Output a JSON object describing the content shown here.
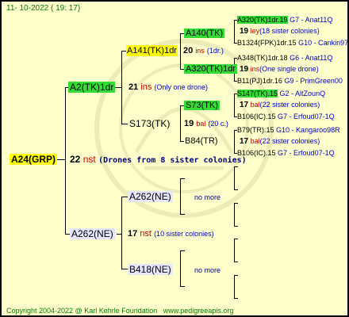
{
  "header": {
    "date": "11- 10-2022 ( 19: 17)"
  },
  "footer": {
    "copyright": "Copyright 2004-2022 @ Karl Kehrle Foundation",
    "site": "www.pedigreeapis.org"
  },
  "root": {
    "name": "A24(GRP)",
    "count": "22",
    "unit": "nst",
    "note": "(Drones from 8 sister colonies)"
  },
  "gen1": {
    "upper": {
      "name": "A2(TK)1dr",
      "count": "21",
      "unit": "ins",
      "note": "(Only one drone)"
    },
    "lower": {
      "name": "A262(NE)",
      "count": "17",
      "unit": "nst",
      "note": "(10 sister colonies)"
    }
  },
  "gen2": {
    "a141": {
      "name": "A141(TK)1dr",
      "count": "20",
      "unit": "ins",
      "note": "(1dr.)"
    },
    "s173": {
      "name": "S173(TK)",
      "count": "19",
      "unit": "bal",
      "note": "(20 c.)"
    },
    "a262ne": {
      "name": "A262(NE)",
      "more": "no more"
    },
    "b418": {
      "name": "B418(NE)",
      "more": "no more"
    }
  },
  "gen3": {
    "a140": {
      "name": "A140(TK)"
    },
    "a320": {
      "name": "A320(TK)1dr"
    },
    "s73": {
      "name": "S73(TK)"
    },
    "b84": {
      "name": "B84(TR)"
    }
  },
  "gen4": [
    {
      "l1a": "A320(TK)1dr.19",
      "l1b": "G7 - Anat11Q",
      "count": "19",
      "unit": "ley",
      "note": "(18 sister colonies)",
      "l3a": "B1324(FPK)1dr.15",
      "l3b": "G10 - Cankiri97Q"
    },
    {
      "l1a": "A348(TK)1dr.18",
      "l1b": "G6 - Anat11Q",
      "count": "19",
      "unit": "ins",
      "note": "(One single drone)",
      "l3a": "B11(PJ)1dr.16",
      "l3b": "G9 - PrimGreen00"
    },
    {
      "l1a": "S147(TK).15",
      "l1b": "G2 - AltZounQ",
      "count": "17",
      "unit": "bal",
      "note": "(22 sister colonies)",
      "l3a": "B106(IC).15",
      "l3b": "G7 - Erfoud07-1Q"
    },
    {
      "l1a": "B79(TR).15",
      "l1b": "G10 - Kangaroo98R",
      "count": "17",
      "unit": "bal",
      "note": "(22 sister colonies)",
      "l3a": "B106(IC).15",
      "l3b": "G7 - Erfoud07-1Q"
    }
  ]
}
